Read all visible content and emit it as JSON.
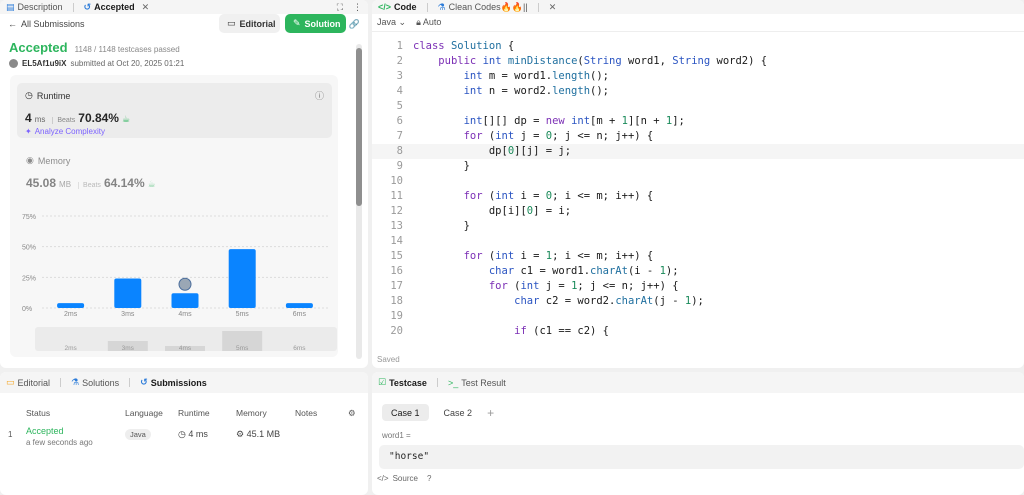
{
  "left_tabs": {
    "description": "Description",
    "accepted": "Accepted"
  },
  "nav": {
    "back_label": "All Submissions"
  },
  "submission": {
    "status": "Accepted",
    "passed": "1148 / 1148 testcases passed",
    "user": "EL5Af1u9iX",
    "submitted": "submitted at Oct 20, 2025 01:21",
    "editorial_btn": "Editorial",
    "solution_btn": "Solution"
  },
  "runtime": {
    "label": "Runtime",
    "value": "4",
    "unit": "ms",
    "beats_label": "Beats",
    "beats": "70.84%",
    "analyze": "Analyze Complexity"
  },
  "memory": {
    "label": "Memory",
    "value": "45.08",
    "unit": "MB",
    "beats_label": "Beats",
    "beats": "64.14%"
  },
  "chart_data": {
    "type": "bar",
    "categories": [
      "2ms",
      "3ms",
      "4ms",
      "5ms",
      "6ms"
    ],
    "values": [
      4,
      24,
      12,
      48,
      4
    ],
    "yticks": [
      "75%",
      "50%",
      "25%",
      "0%"
    ],
    "ylim": [
      0,
      75
    ],
    "highlight": "4ms",
    "bar_color": "#0a84ff"
  },
  "code_header": {
    "code": "Code",
    "clean": "Clean Codes🔥🔥||",
    "lang": "Java",
    "auto": "Auto",
    "saved": "Saved"
  },
  "code_lines": [
    "class Solution {",
    "    public int minDistance(String word1, String word2) {",
    "        int m = word1.length();",
    "        int n = word2.length();",
    "",
    "        int[][] dp = new int[m + 1][n + 1];",
    "        for (int j = 0; j <= n; j++) {",
    "            dp[0][j] = j;",
    "        }",
    "",
    "        for (int i = 0; i <= m; i++) {",
    "            dp[i][0] = i;",
    "        }",
    "",
    "        for (int i = 1; i <= m; i++) {",
    "            char c1 = word1.charAt(i - 1);",
    "            for (int j = 1; j <= n; j++) {",
    "                char c2 = word2.charAt(j - 1);",
    "",
    "                if (c1 == c2) {"
  ],
  "bottom_tabs": {
    "editorial": "Editorial",
    "solutions": "Solutions",
    "submissions": "Submissions"
  },
  "sub_table": {
    "headers": [
      "Status",
      "Language",
      "Runtime",
      "Memory",
      "Notes"
    ],
    "row": {
      "index": "1",
      "status": "Accepted",
      "time": "a few seconds ago",
      "lang": "Java",
      "runtime": "4 ms",
      "memory": "45.1 MB"
    }
  },
  "testcase": {
    "tab": "Testcase",
    "result_tab": "Test Result",
    "case1": "Case 1",
    "case2": "Case 2",
    "plus": "+",
    "var": "word1 =",
    "value": "\"horse\"",
    "source": "Source"
  },
  "colors": {
    "accent_green": "#2db55d",
    "brand_blue": "#0a84ff",
    "keyword": "#7b2fb5"
  }
}
